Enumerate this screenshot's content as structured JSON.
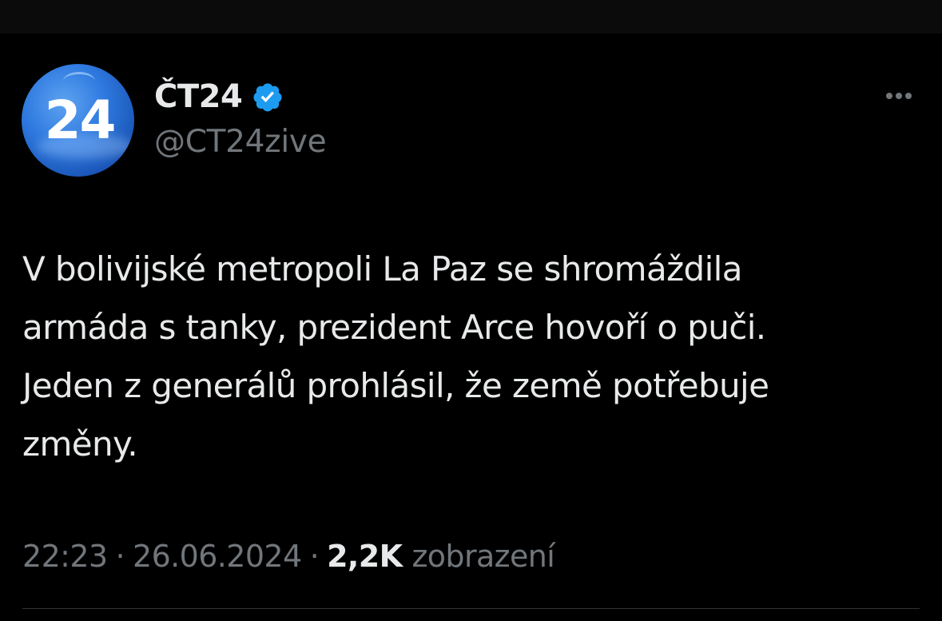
{
  "account": {
    "avatar_text": "24",
    "display_name": "ČT24",
    "verified": true,
    "handle": "@CT24zive"
  },
  "tweet": {
    "text": "V bolivijské metropoli La Paz se shromáždila\narmáda s tanky, prezident Arce hovoří o puči.\nJeden z generálů prohlásil, že země potřebuje\nzměny.",
    "time": "22:23",
    "date": "26.06.2024",
    "separator": "·",
    "views_count": "2,2K",
    "views_label": "zobrazení"
  },
  "colors": {
    "background": "#000000",
    "text_primary": "#e7e9ea",
    "text_secondary": "#71767b",
    "verified_blue": "#1d9bf0",
    "divider": "#2f3336"
  },
  "icons": {
    "verified": "verified-badge-icon",
    "more": "more-horizontal-icon"
  }
}
